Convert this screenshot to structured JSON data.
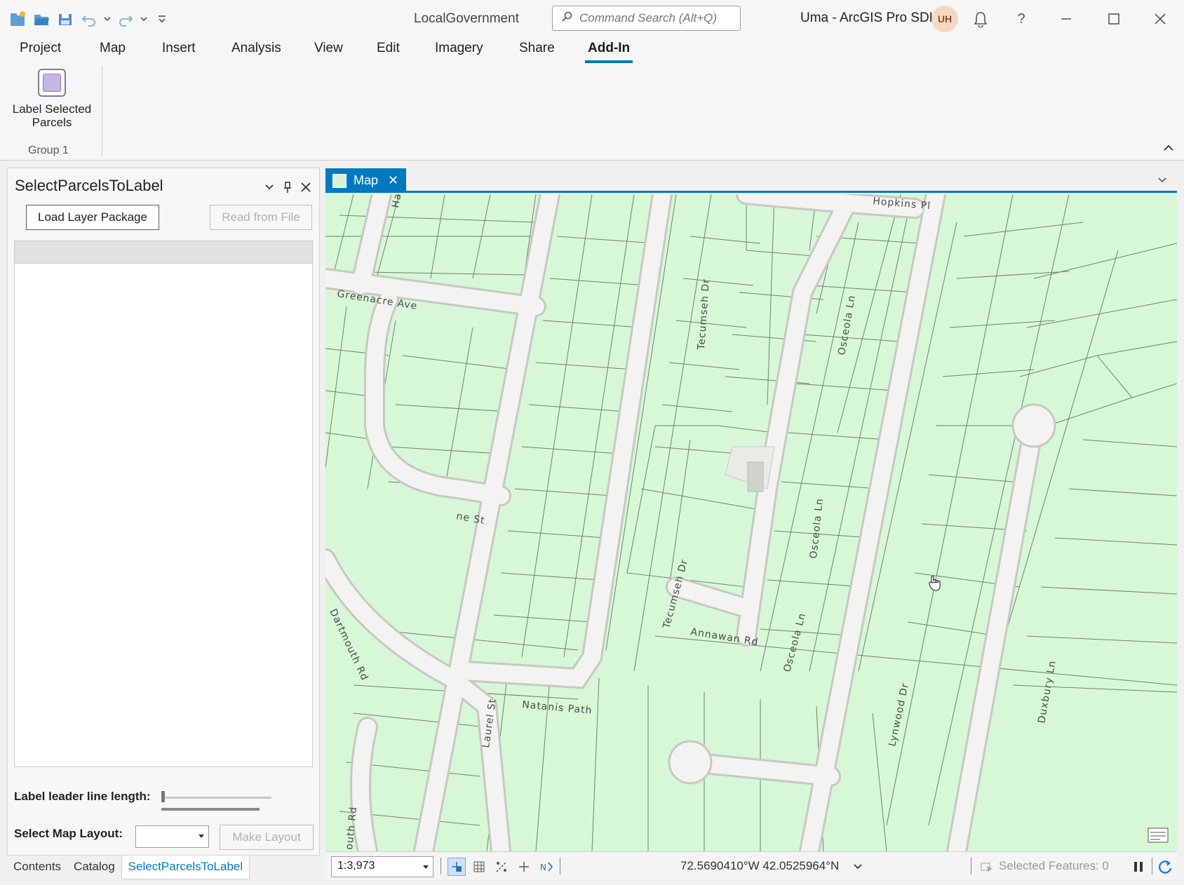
{
  "titlebar": {
    "project_name": "LocalGovernment",
    "search_placeholder": "Command Search (Alt+Q)",
    "user": "Uma - ArcGIS Pro SDK",
    "avatar_initials": "UH",
    "help": "?"
  },
  "ribbon": {
    "tabs": [
      "Project",
      "Map",
      "Insert",
      "Analysis",
      "View",
      "Edit",
      "Imagery",
      "Share",
      "Add-In"
    ],
    "active_tab": "Add-In",
    "button_label_line1": "Label Selected",
    "button_label_line2": "Parcels",
    "group_label": "Group 1"
  },
  "pane": {
    "title": "SelectParcelsToLabel",
    "load_button": "Load Layer Package",
    "read_button": "Read from File",
    "leader_label": "Label leader line length:",
    "layout_label": "Select Map Layout:",
    "layout_value": "",
    "make_layout_button": "Make Layout",
    "leader_value": 0
  },
  "bottom_tabs": [
    "Contents",
    "Catalog",
    "SelectParcelsToLabel"
  ],
  "bottom_tab_active": "SelectParcelsToLabel",
  "map": {
    "tab_label": "Map",
    "close_glyph": "✕",
    "streets": {
      "hopkins": "Hopkins Pl",
      "greenacre": "Greenacre Ave",
      "tecumseh1": "Tecumseh Dr",
      "tecumseh2": "Tecumseh Dr",
      "osceola1": "Osceola Ln",
      "osceola2": "Osceola Ln",
      "osceola3": "Osceola Ln",
      "annawan": "Annawan Rd",
      "natanis": "Natanis Path",
      "laurel": "Laurel St",
      "dartmouth": "Dartmouth Rd",
      "lynwood": "Lynwood Dr",
      "duxbury": "Duxbury Ln",
      "pine": "ne St",
      "ha": "Ha",
      "south": "outh Rd"
    }
  },
  "status": {
    "scale": "1:3,973",
    "coordinates": "72.5690410°W 42.0525964°N",
    "selected_features": "Selected Features: 0"
  },
  "colors": {
    "accent": "#0079c1",
    "parcel_fill": "#d6f8d6",
    "street": "#f3f3f1"
  }
}
